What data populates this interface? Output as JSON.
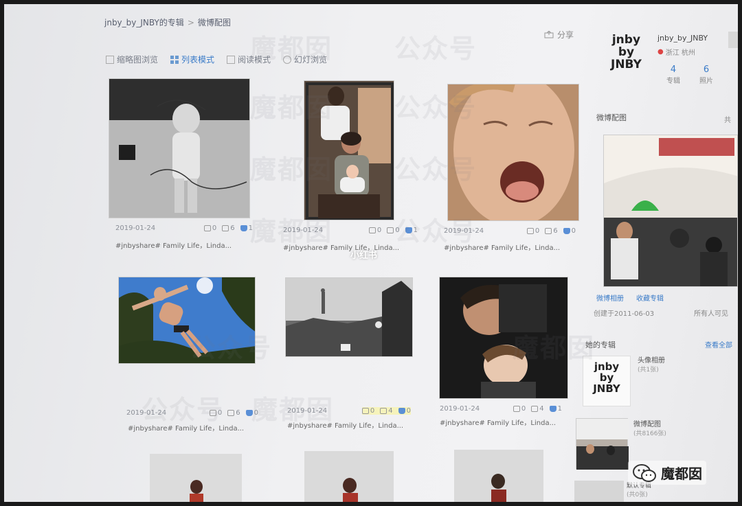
{
  "header": {
    "breadcrumb_owner": "jnby_by_JNBY的专辑",
    "breadcrumb_separator": ">",
    "breadcrumb_current": "微博配图",
    "share_label": "分享"
  },
  "view_modes": [
    {
      "label": "缩略图浏览",
      "active": false
    },
    {
      "label": "列表模式",
      "active": true
    },
    {
      "label": "阅读模式",
      "active": false
    },
    {
      "label": "幻灯浏览",
      "active": false
    }
  ],
  "photos": [
    {
      "date": "2019-01-24",
      "reposts": "0",
      "comments": "6",
      "likes": "1",
      "caption": "#jnbyshare# Family Life，Linda..."
    },
    {
      "date": "2019-01-24",
      "reposts": "0",
      "comments": "0",
      "likes": "1",
      "caption": "#jnbyshare# Family Life，Linda..."
    },
    {
      "date": "2019-01-24",
      "reposts": "0",
      "comments": "6",
      "likes": "0",
      "caption": "#jnbyshare# Family Life，Linda..."
    },
    {
      "date": "2019-01-24",
      "reposts": "0",
      "comments": "6",
      "likes": "0",
      "caption": "#jnbyshare# Family Life，Linda..."
    },
    {
      "date": "2019-01-24",
      "reposts": "0",
      "comments": "4",
      "likes": "0",
      "caption": "#jnbyshare# Family Life，Linda..."
    },
    {
      "date": "2019-01-24",
      "reposts": "0",
      "comments": "4",
      "likes": "1",
      "caption": "#jnbyshare# Family Life，Linda..."
    }
  ],
  "profile": {
    "logo_lines": [
      "jnby",
      "by",
      "JNBY"
    ],
    "name": "jnby_by_JNBY",
    "location": "浙江 杭州",
    "albums_count": "4",
    "albums_label": "专辑",
    "photos_count": "6",
    "photos_label": "照片"
  },
  "sidebar": {
    "album_title": "微博配图",
    "album_total": "共",
    "album_link_1": "微博相册",
    "album_link_2": "收藏专辑",
    "created": "创建于2011-06-03",
    "visibility": "所有人可见",
    "his_albums_title": "她的专辑",
    "view_all": "查看全部",
    "album_items": [
      {
        "name": "头像相册",
        "count": "(共1张)"
      },
      {
        "name": "微博配图",
        "count": "(共8166张)"
      },
      {
        "name": "默认专辑",
        "count": "(共0张)"
      }
    ],
    "small_logo_lines": [
      "jnby",
      "by",
      "JNBY"
    ]
  },
  "overlay": {
    "xiaohongshu": "小红书",
    "wechat_brand": "魔都囡",
    "watermark_text_1": "魔都囡",
    "watermark_text_2": "公众号"
  }
}
